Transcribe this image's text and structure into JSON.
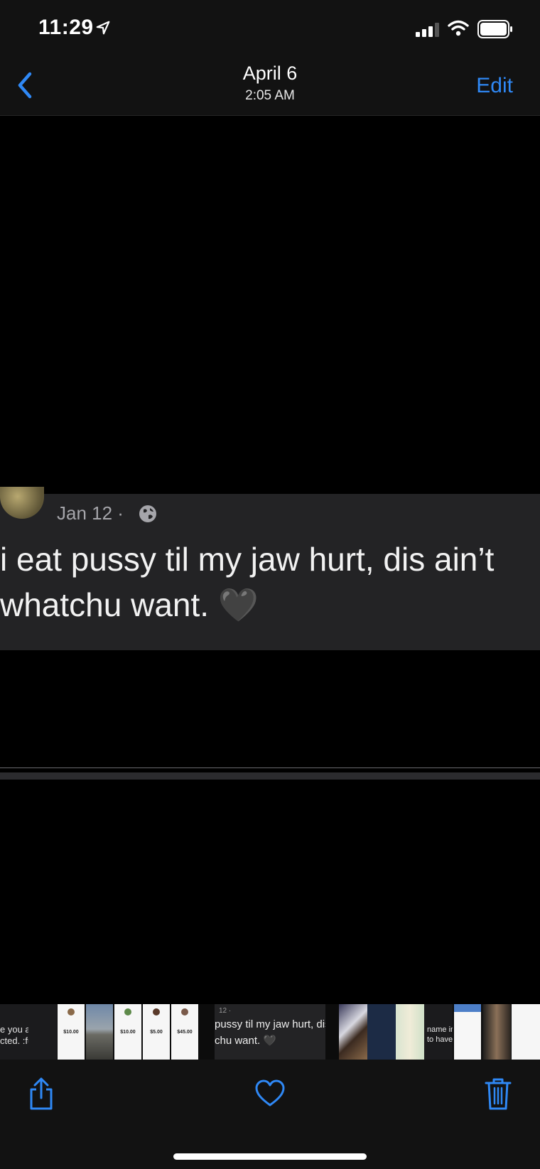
{
  "status_bar": {
    "time": "11:29",
    "icons": [
      "location-arrow-icon",
      "cellular-signal-icon",
      "wifi-icon",
      "battery-icon"
    ]
  },
  "nav": {
    "back_icon": "chevron-left-icon",
    "title": "April 6",
    "subtitle": "2:05 AM",
    "edit_label": "Edit"
  },
  "post": {
    "date": "Jan 12 ·",
    "visibility_icon": "globe-icon",
    "line1": "i eat pussy til my jaw hurt, dis ain’t",
    "line2": "whatchu want. 🖤"
  },
  "thumbnails": {
    "first": {
      "line1": "e you au, you",
      "line2": "cted. :fully😔"
    },
    "amounts": [
      "$10.00",
      "$10.00",
      "$5.00",
      "$45.00"
    ],
    "tweet": {
      "head": "12 ·",
      "line1": "pussy til my jaw hurt, dis",
      "line2": "chu want. 🖤"
    },
    "note": {
      "line1": "name in",
      "line2": "to have"
    }
  },
  "toolbar": {
    "share_icon": "share-icon",
    "favorite_icon": "heart-icon",
    "delete_icon": "trash-icon"
  },
  "colors": {
    "accent": "#2f88f5",
    "bar_background": "#121212",
    "card_background": "#232325"
  }
}
